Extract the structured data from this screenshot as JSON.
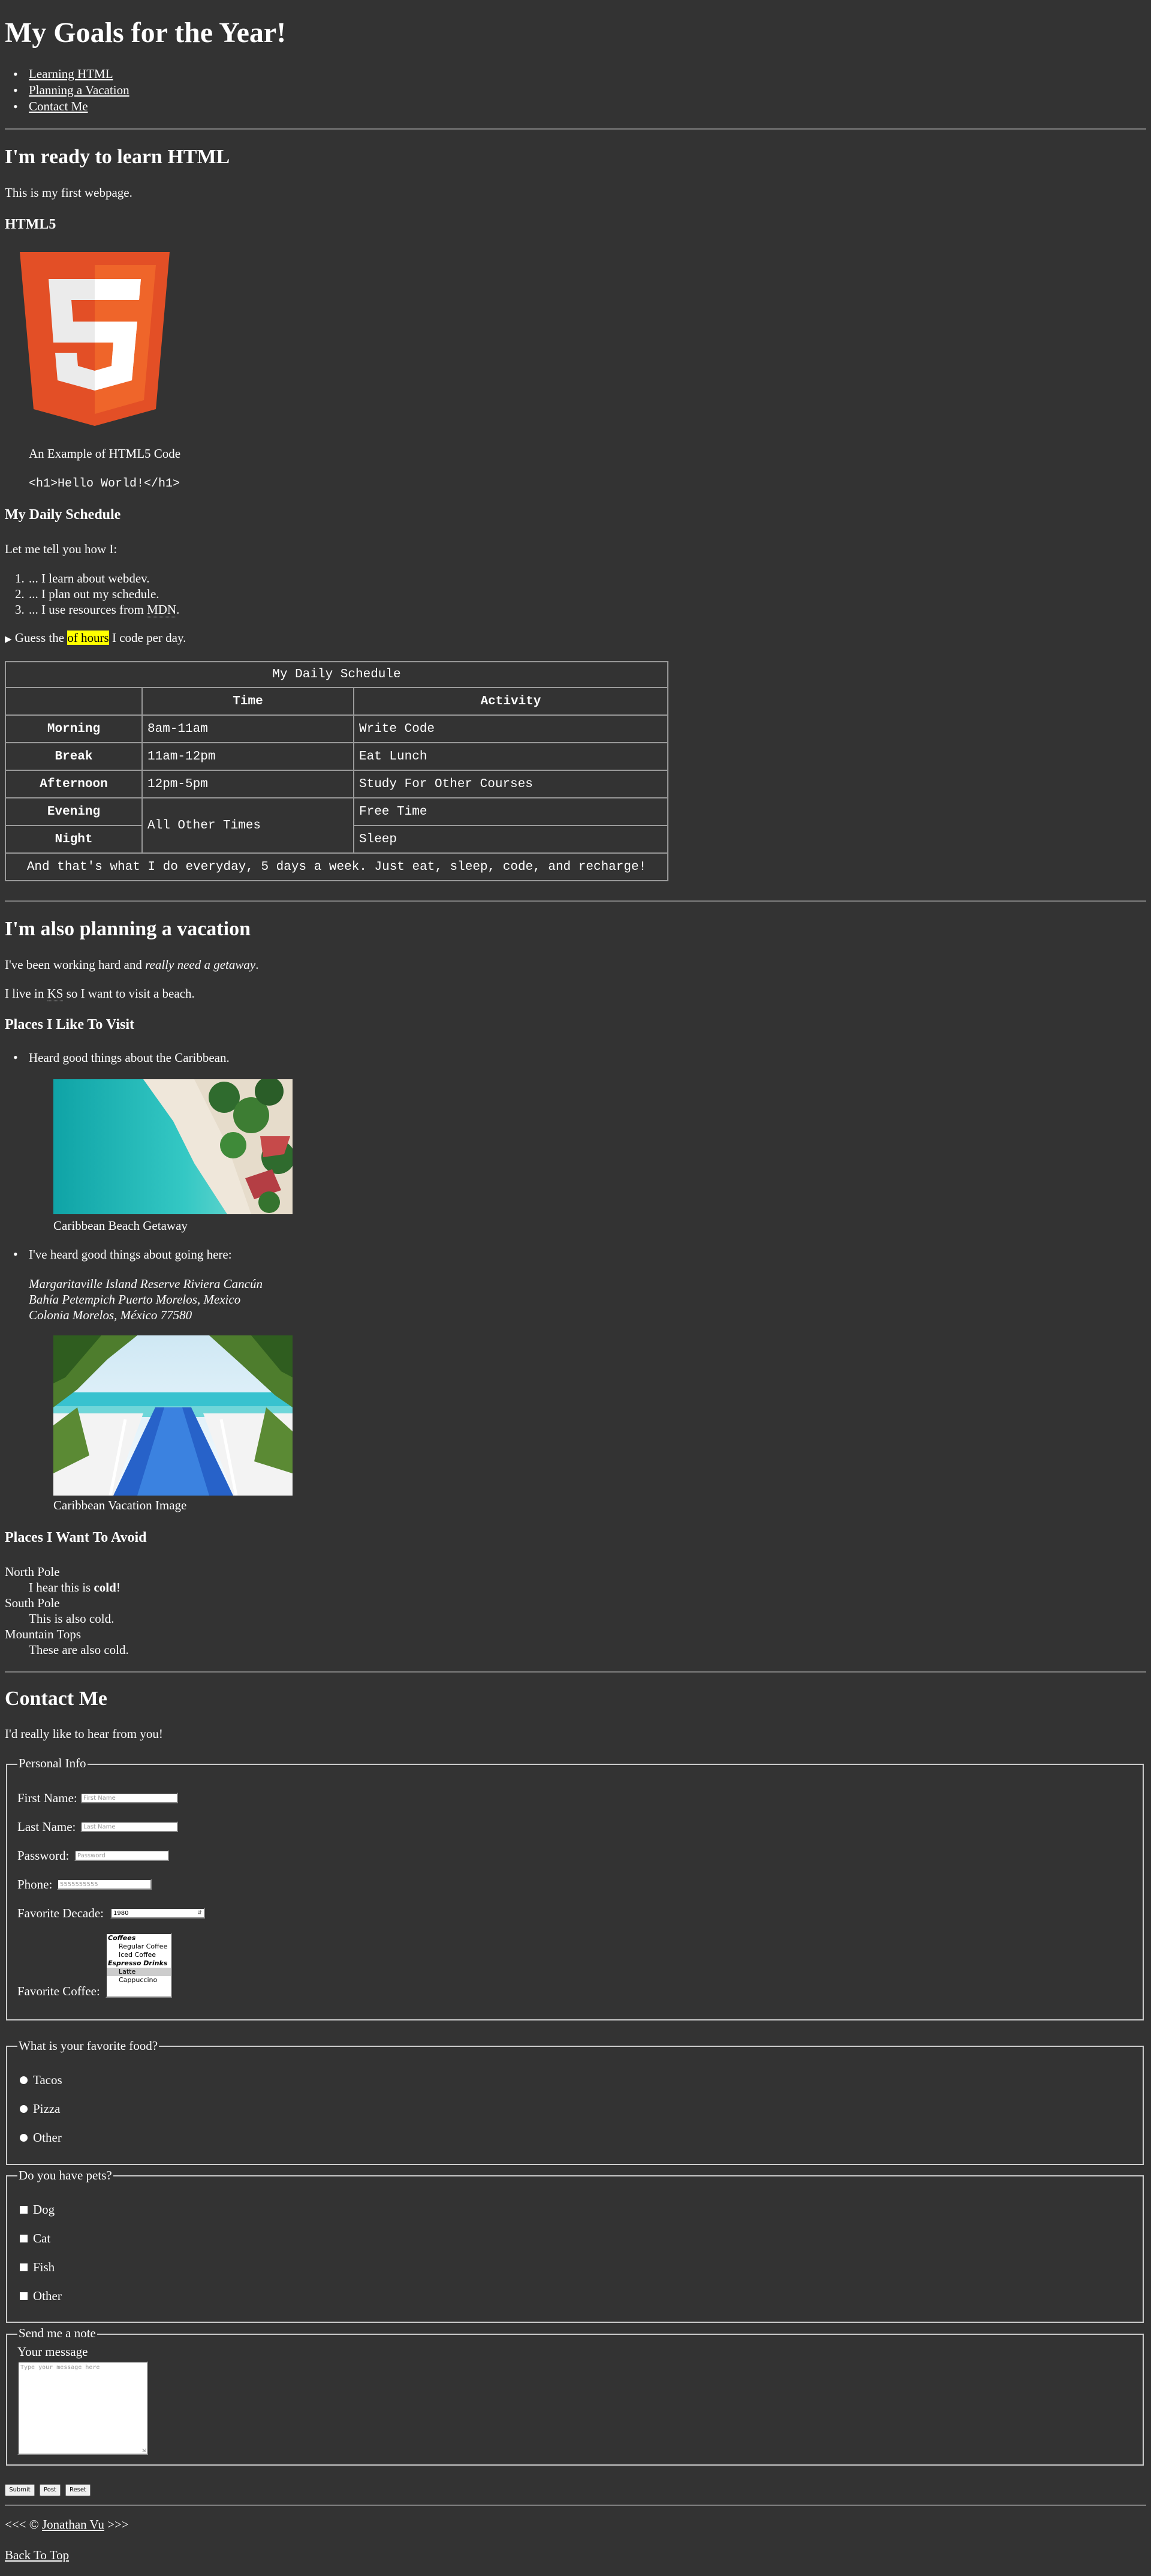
{
  "header": {
    "title": "My Goals for the Year!",
    "nav": [
      "Learning HTML",
      "Planning a Vacation",
      "Contact Me"
    ]
  },
  "html_section": {
    "heading": "I'm ready to learn HTML",
    "intro": "This is my first webpage.",
    "subheading": "HTML5",
    "figure_caption": "An Example of HTML5 Code",
    "code_sample": "<h1>Hello World!</h1>"
  },
  "schedule": {
    "heading": "My Daily Schedule",
    "intro": "Let me tell you how I:",
    "list": [
      {
        "prefix": "... I learn about webdev.",
        "abbr": "",
        "suffix": ""
      },
      {
        "prefix": "... I plan out my schedule.",
        "abbr": "",
        "suffix": ""
      },
      {
        "prefix": "... I use resources from ",
        "abbr": "MDN",
        "suffix": "."
      }
    ],
    "details": {
      "before": "Guess the ",
      "marked": "of hours",
      "after": " I code per day."
    },
    "table": {
      "caption": "My Daily Schedule",
      "headers": [
        "",
        "Time",
        "Activity"
      ],
      "rows": [
        {
          "label": "Morning",
          "time": "8am-11am",
          "activity": "Write Code"
        },
        {
          "label": "Break",
          "time": "11am-12pm",
          "activity": "Eat Lunch"
        },
        {
          "label": "Afternoon",
          "time": "12pm-5pm",
          "activity": "Study For Other Courses"
        },
        {
          "label": "Evening",
          "time": "All Other Times",
          "activity": "Free Time"
        },
        {
          "label": "Night",
          "time": "",
          "activity": "Sleep"
        }
      ],
      "footer": "And that's what I do everyday, 5 days a week. Just eat, sleep, code, and recharge!"
    }
  },
  "vacation": {
    "heading": "I'm also planning a vacation",
    "p1_before": "I've been working hard and ",
    "p1_em": "really need a getaway",
    "p1_after": ".",
    "p2_before": "I live in ",
    "p2_abbr": "KS",
    "p2_after": " so I want to visit a beach.",
    "places_heading": "Places I Like To Visit",
    "place1": "Heard good things about the Caribbean.",
    "place1_caption": "Caribbean Beach Getaway",
    "place2": "I've heard good things about going here:",
    "address": [
      "Margaritaville Island Reserve Riviera Cancún",
      "Bahía Petempich Puerto Morelos, Mexico",
      "Colonia Morelos, México 77580"
    ],
    "place2_caption": "Caribbean Vacation Image",
    "avoid_heading": "Places I Want To Avoid",
    "avoid": [
      {
        "term": "North Pole",
        "desc_before": "I hear this is ",
        "desc_strong": "cold",
        "desc_after": "!"
      },
      {
        "term": "South Pole",
        "desc_before": "This is also cold.",
        "desc_strong": "",
        "desc_after": ""
      },
      {
        "term": "Mountain Tops",
        "desc_before": "These are also cold.",
        "desc_strong": "",
        "desc_after": ""
      }
    ]
  },
  "contact": {
    "heading": "Contact Me",
    "intro": "I'd really like to hear from you!",
    "personal": {
      "legend": "Personal Info",
      "first_label": "First Name:",
      "first_placeholder": "First Name",
      "last_label": "Last Name:",
      "last_placeholder": "Last Name",
      "password_label": "Password:",
      "password_placeholder": "Password",
      "phone_label": "Phone:",
      "phone_placeholder": "5555555555",
      "decade_label": "Favorite Decade:",
      "decade_value": "1980",
      "coffee_label": "Favorite Coffee:",
      "coffee_options": [
        {
          "type": "group",
          "text": "Coffees"
        },
        {
          "type": "option",
          "text": "Regular Coffee"
        },
        {
          "type": "option",
          "text": "Iced Coffee"
        },
        {
          "type": "group",
          "text": "Espresso Drinks"
        },
        {
          "type": "option",
          "text": "Latte",
          "selected": true
        },
        {
          "type": "option",
          "text": "Cappuccino"
        }
      ]
    },
    "food": {
      "legend": "What is your favorite food?",
      "options": [
        "Tacos",
        "Pizza",
        "Other"
      ]
    },
    "pets": {
      "legend": "Do you have pets?",
      "options": [
        "Dog",
        "Cat",
        "Fish",
        "Other"
      ]
    },
    "note": {
      "legend": "Send me a note",
      "label": "Your message",
      "placeholder": "Type your message here"
    },
    "buttons": [
      "Submit",
      "Post",
      "Reset"
    ]
  },
  "footer": {
    "before": "<<< © ",
    "author": "Jonathan Vu",
    "after": " >>>",
    "back_to_top": "Back To Top"
  },
  "colors": {
    "background": "#333333",
    "text": "#ffffff",
    "mark": "#ffff00",
    "html5_orange": "#e34f26"
  }
}
